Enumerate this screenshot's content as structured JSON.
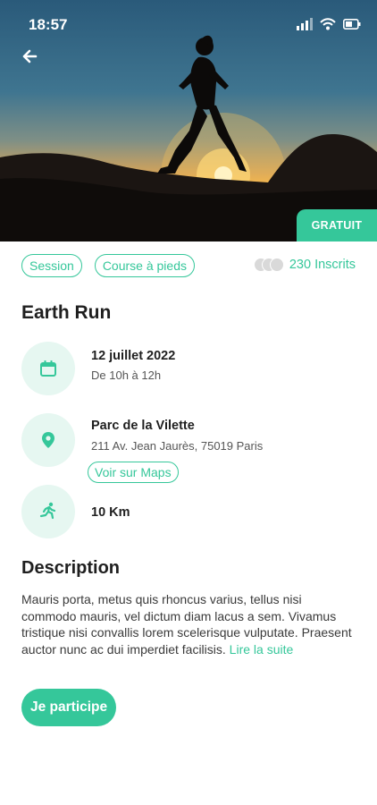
{
  "status_bar": {
    "time": "18:57"
  },
  "hero": {
    "badge": "GRATUIT"
  },
  "tags": [
    "Session",
    "Course à pieds"
  ],
  "participants": {
    "label": "230 Inscrits"
  },
  "event": {
    "title": "Earth Run",
    "date": "12 juillet 2022",
    "hours": "De 10h à 12h",
    "place_name": "Parc de la Vilette",
    "address": "211 Av. Jean Jaurès, 75019 Paris",
    "maps_label": "Voir sur Maps",
    "distance": "10 Km"
  },
  "description": {
    "title": "Description",
    "text": "Mauris porta, metus quis rhoncus varius, tellus nisi commodo mauris, vel dictum diam lacus a sem. Vivamus tristique nisi convallis lorem scelerisque vulputate. Praesent auctor nunc ac dui imperdiet facilisis.",
    "read_more": "Lire la suite"
  },
  "cta": {
    "label": "Je participe"
  },
  "colors": {
    "accent": "#35c79a",
    "icon_bg": "#e6f7f1"
  },
  "icons": [
    "arrow-left-icon",
    "signal-icon",
    "wifi-icon",
    "battery-icon",
    "calendar-icon",
    "location-pin-icon",
    "running-icon"
  ]
}
